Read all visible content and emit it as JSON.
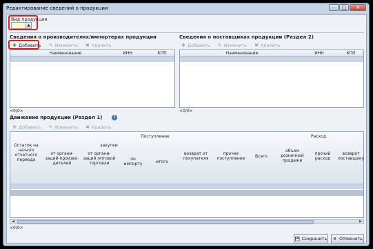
{
  "window": {
    "title": "Редактирование сведений о продукции"
  },
  "product_type": {
    "label": "Вид продукции",
    "value": ""
  },
  "producers": {
    "header": "Сведения о производителях/импортерах продукции",
    "toolbar": {
      "add": "Добавить",
      "edit": "Изменить",
      "delete": "Удалить"
    },
    "columns": [
      "Наименование",
      "ИНН",
      "КПП"
    ],
    "pager": "<0/0>"
  },
  "suppliers": {
    "header": "Сведения о поставщиках продукции (Раздел 2)",
    "toolbar": {
      "add": "Добавить",
      "edit": "Изменить",
      "delete": "Удалить"
    },
    "columns": [
      "Наименование",
      "ИНН",
      "КПП"
    ],
    "pager": "<0/0>"
  },
  "movement": {
    "header": "Движение продукции (Раздел 1)",
    "toolbar": {
      "add": "Добавить",
      "edit": "Изменить",
      "delete": "Удалить"
    },
    "group_receipt": "Поступление",
    "group_purchases": "закупки",
    "group_expense": "Расход",
    "columns": {
      "opening_balance": "Остаток на начало отчетного периода",
      "from_producers": "от органи-заций-произво-дителей",
      "from_wholesale": "от органи-заций оптовой торговли",
      "import": "по импорту",
      "total_purchases": "итого",
      "buyer_return": "возврат от покупателя",
      "other_receipt": "прочее поступление",
      "total": "Всего",
      "retail_volume": "объем розничной продажи",
      "other_expense": "прочий расход",
      "supplier_return": "возврат поставщику"
    },
    "pager": "<0/0>"
  },
  "buttons": {
    "save": "Сохранить",
    "cancel": "Отменить"
  },
  "colors": {
    "highlight": "#e02020",
    "combo_bg": "#fff8c8"
  }
}
